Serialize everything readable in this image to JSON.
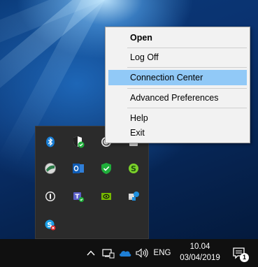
{
  "context_menu": {
    "items": [
      {
        "label": "Open",
        "bold": true
      },
      {
        "label": "Log Off"
      },
      {
        "label": "Connection Center",
        "highlighted": true
      },
      {
        "label": "Advanced Preferences"
      },
      {
        "label": "Help"
      },
      {
        "label": "Exit"
      }
    ]
  },
  "tray_flyout": {
    "icons": [
      "bluetooth-icon",
      "windows-defender-icon",
      "citrix-receiver-icon",
      "usb-icon",
      "network-drive-icon",
      "outlook-icon",
      "security-shield-icon",
      "skype-status-icon",
      "1password-icon",
      "teams-icon",
      "nvidia-icon",
      "sync-icon",
      "skype-error-icon"
    ]
  },
  "taskbar": {
    "chevron": "^",
    "language": "ENG",
    "clock": {
      "time": "10.04",
      "date": "03/04/2019"
    },
    "notifications": {
      "count": "1"
    }
  },
  "colors": {
    "menu_highlight": "#91c9f7",
    "menu_bg": "#f2f2f2",
    "taskbar_bg": "#101010",
    "flyout_bg": "#2b2b2b"
  }
}
